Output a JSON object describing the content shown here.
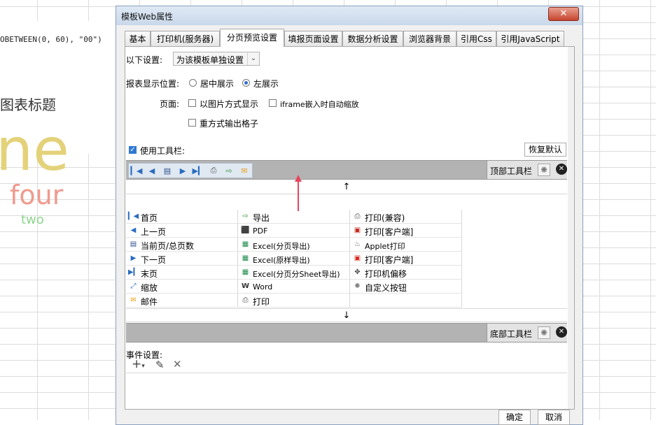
{
  "background": {
    "formula": "OBETWEEN(0, 60), \"00\")",
    "chart_title": "图表标题",
    "words": [
      "ne",
      "four",
      "two"
    ]
  },
  "dialog": {
    "title": "模板Web属性",
    "close": "✕",
    "tabs": [
      {
        "label": "基本"
      },
      {
        "label": "打印机(服务器)"
      },
      {
        "label": "分页预览设置"
      },
      {
        "label": "填报页面设置"
      },
      {
        "label": "数据分析设置"
      },
      {
        "label": "浏览器背景"
      },
      {
        "label": "引用Css"
      },
      {
        "label": "引用JavaScript"
      }
    ],
    "active_tab": "分页预览设置",
    "settings_label": "以下设置:",
    "settings_value": "为该模板单独设置",
    "display_position_label": "报表显示位置:",
    "radio_center": "居中展示",
    "radio_left": "左展示",
    "page_label": "页面:",
    "chk_image": "以图片方式显示",
    "chk_iframe": "iframe嵌入时自动缩放",
    "chk_heavy": "重方式输出格子",
    "use_toolbar": "使用工具栏:",
    "restore_default": "恢复默认",
    "top_toolbar": "顶部工具栏",
    "bottom_toolbar": "底部工具栏",
    "up_arrow": "↑",
    "down_arrow": "↓",
    "columns": [
      [
        {
          "icon": "first-page-icon",
          "label": "首页"
        },
        {
          "icon": "prev-page-icon",
          "label": "上一页"
        },
        {
          "icon": "page-count-icon",
          "label": "当前页/总页数"
        },
        {
          "icon": "next-page-icon",
          "label": "下一页"
        },
        {
          "icon": "last-page-icon",
          "label": "末页"
        },
        {
          "icon": "zoom-icon",
          "label": "缩放"
        },
        {
          "icon": "mail-icon",
          "label": "邮件"
        }
      ],
      [
        {
          "icon": "export-icon",
          "label": "导出"
        },
        {
          "icon": "pdf-icon",
          "label": "PDF"
        },
        {
          "icon": "excel-icon",
          "label": "Excel(分页导出)"
        },
        {
          "icon": "excel-icon",
          "label": "Excel(原样导出)"
        },
        {
          "icon": "excel-icon",
          "label": "Excel(分页分Sheet导出)"
        },
        {
          "icon": "word-icon",
          "label": "Word"
        },
        {
          "icon": "print-icon",
          "label": "打印"
        }
      ],
      [
        {
          "icon": "print-icon",
          "label": "打印(兼容)"
        },
        {
          "icon": "flash-print-icon",
          "label": "打印[客户端]"
        },
        {
          "icon": "applet-icon",
          "label": "Applet打印"
        },
        {
          "icon": "pdf-print-icon",
          "label": "打印[客户端]"
        },
        {
          "icon": "move-icon",
          "label": "打印机偏移"
        },
        {
          "icon": "gear-icon",
          "label": "自定义按钮"
        }
      ]
    ],
    "event_label": "事件设置:",
    "ok": "确定",
    "cancel": "取消"
  },
  "colors": {
    "toolbar_gray": "#b3b3b3",
    "accent_blue": "#2f79d5",
    "pink_arrow": "#e8455e"
  }
}
